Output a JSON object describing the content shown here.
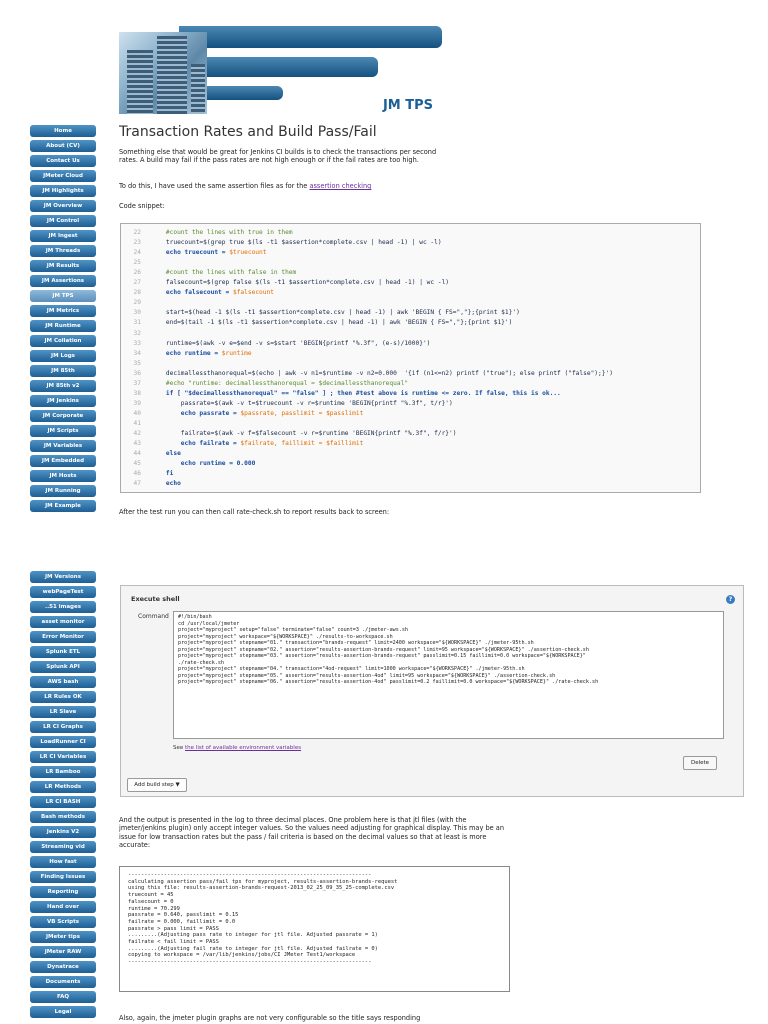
{
  "header": {
    "brand": "JM TPS"
  },
  "sidebar_top": [
    "Home",
    "About (CV)",
    "Contact Us",
    "JMeter Cloud",
    "JM Highlights",
    "JM Overview",
    "JM Control",
    "JM Ingest",
    "JM Threads",
    "JM Results",
    "JM Assertions",
    "JM TPS",
    "JM Metrics",
    "JM Runtime",
    "JM Collation",
    "JM Logs",
    "JM 85th",
    "JM 85th v2",
    "JM Jenkins",
    "JM Corporate",
    "JM Scripts",
    "JM Variables",
    "JM Embedded",
    "JM Hosts",
    "JM Running",
    "JM Example"
  ],
  "sidebar_top_selected": 11,
  "sidebar_bottom": [
    "JM Versions",
    "webPageTest",
    "..51 images",
    "asset monitor",
    "Error Monitor",
    "Splunk ETL",
    "Splunk API",
    "AWS bash",
    "LR Rules OK",
    "LR Slave",
    "LR CI Graphs",
    "LoadRunner CI",
    "LR CI Variables",
    "LR Bamboo",
    "LR Methods",
    "LR CI BASH",
    "Bash methods",
    "Jenkins V2",
    "Streaming vid",
    "How fast",
    "Finding Issues",
    "Reporting",
    "Hand over",
    "VB Scripts",
    "JMeter tips",
    "JMeter RAW",
    "Dynatrace",
    "Documents",
    "FAQ",
    "Legal"
  ],
  "content": {
    "title": "Transaction Rates and Build Pass/Fail",
    "intro": "Something else that would be great for Jenkins CI builds is to check the transactions per second rates. A build may fail if the pass rates are not high enough or if the fail rates are too high.",
    "todo_prefix": "To do this, I have used the same assertion files as for the ",
    "todo_link": "assertion checking",
    "code_label": "Code snippet:",
    "after_code": "After the test run you can then call rate-check.sh to report results back to screen:",
    "output_para": "And the output is presented in the log to three decimal places. One problem here is that jtl files (with the jmeter/jenkins plugin) only accept integer values. So the values need adjusting for graphical display. This may be an issue for low transaction rates but the pass / fail criteria is based on the decimal values so that at least is more accurate:",
    "bottom_para": "Also, again, the jmeter plugin graphs are not very configurable so the title says responding"
  },
  "code_snippet": [
    {
      "n": "22",
      "t": "    #count the lines with true in them",
      "k": "com"
    },
    {
      "n": "23",
      "t": "    truecount=$(grep true $(ls -t1 $assertion*complete.csv | head -1) | wc -l)",
      "k": "txt"
    },
    {
      "n": "24",
      "t": "    echo truecount = $truecount",
      "k": "echo"
    },
    {
      "n": "25",
      "t": "",
      "k": "txt"
    },
    {
      "n": "26",
      "t": "    #count the lines with false in them",
      "k": "com"
    },
    {
      "n": "27",
      "t": "    falsecount=$(grep false $(ls -t1 $assertion*complete.csv | head -1) | wc -l)",
      "k": "txt"
    },
    {
      "n": "28",
      "t": "    echo falsecount = $falsecount",
      "k": "echo"
    },
    {
      "n": "29",
      "t": "",
      "k": "txt"
    },
    {
      "n": "30",
      "t": "    start=$(head -1 $(ls -t1 $assertion*complete.csv | head -1) | awk 'BEGIN { FS=\",\"};{print $1}')",
      "k": "txt"
    },
    {
      "n": "31",
      "t": "    end=$(tail -1 $(ls -t1 $assertion*complete.csv | head -1) | awk 'BEGIN { FS=\",\"};{print $1}')",
      "k": "txt"
    },
    {
      "n": "32",
      "t": "",
      "k": "txt"
    },
    {
      "n": "33",
      "t": "    runtime=$(awk -v e=$end -v s=$start 'BEGIN{printf \"%.3f\", (e-s)/1000}')",
      "k": "txt"
    },
    {
      "n": "34",
      "t": "    echo runtime = $runtime",
      "k": "echo"
    },
    {
      "n": "35",
      "t": "",
      "k": "txt"
    },
    {
      "n": "36",
      "t": "    decimallessthanorequal=$(echo | awk -v n1=$runtime -v n2=0.000  '{if (n1<=n2) printf (\"true\"); else printf (\"false\");}')",
      "k": "txt"
    },
    {
      "n": "37",
      "t": "    #echo \"runtime: decimallessthanorequal = $decimallessthanorequal\"",
      "k": "com"
    },
    {
      "n": "38",
      "t": "    if [ \"$decimallessthanorequal\" == \"false\" ] ; then #test above is runtime <= zero. If false, this is ok...",
      "k": "if"
    },
    {
      "n": "39",
      "t": "        passrate=$(awk -v t=$truecount -v r=$runtime 'BEGIN{printf \"%.3f\", t/r}')",
      "k": "txt"
    },
    {
      "n": "40",
      "t": "        echo passrate = $passrate, passlimit = $passlimit",
      "k": "echo"
    },
    {
      "n": "41",
      "t": "",
      "k": "txt"
    },
    {
      "n": "42",
      "t": "        failrate=$(awk -v f=$falsecount -v r=$runtime 'BEGIN{printf \"%.3f\", f/r}')",
      "k": "txt"
    },
    {
      "n": "43",
      "t": "        echo failrate = $failrate, faillimit = $faillimit",
      "k": "echo"
    },
    {
      "n": "44",
      "t": "    else",
      "k": "kw"
    },
    {
      "n": "45",
      "t": "        echo runtime = 0.000",
      "k": "echo"
    },
    {
      "n": "46",
      "t": "    fi",
      "k": "kw"
    },
    {
      "n": "47",
      "t": "    echo",
      "k": "kw"
    }
  ],
  "jenkins": {
    "header": "Execute shell",
    "help": "?",
    "label": "Command",
    "command_lines": [
      "#!/bin/bash",
      "",
      "cd /usr/local/jmeter",
      "project=\"myproject\" setup=\"false\" terminate=\"false\" count=3 ./jmeter-aws.sh",
      "",
      "project=\"myproject\" workspace=\"${WORKSPACE}\" ./results-to-workspace.sh",
      "",
      "project=\"myproject\" stepname=\"01.\" transaction=\"brands-request\" limit=2400 workspace=\"${WORKSPACE}\" ./jmeter-95th.sh",
      "project=\"myproject\" stepname=\"02.\" assertion=\"results-assertion-brands-request\" limit=95 workspace=\"${WORKSPACE}\" ./assertion-check.sh",
      "project=\"myproject\" stepname=\"03.\" assertion=\"results-assertion-brands-request\" passlimit=0.15 faillimit=0.0 workspace=\"${WORKSPACE}\"",
      "./rate-check.sh",
      "",
      "project=\"myproject\" stepname=\"04.\" transaction=\"4od-request\" limit=1000 workspace=\"${WORKSPACE}\" ./jmeter-95th.sh",
      "project=\"myproject\" stepname=\"05.\" assertion=\"results-assertion-4od\" limit=95 workspace=\"${WORKSPACE}\" ./assertion-check.sh",
      "project=\"myproject\" stepname=\"06.\" assertion=\"results-assertion-4od\" passlimit=0.2 faillimit=0.0 workspace=\"${WORKSPACE}\" ./rate-check.sh"
    ],
    "see_prefix": "See ",
    "see_link": "the list of available environment variables",
    "delete": "Delete",
    "add_step": "Add build step ▼"
  },
  "output_lines": [
    "---------------------------------------------------------------------------",
    "calculating assertion pass/fail tps for myproject, results-assertion-brands-request",
    "using this file: results-assertion-brands-request-2013_02_25_09_35_25-complete.csv",
    "truecount = 45",
    "falsecount = 0",
    "runtime = 70.299",
    "passrate = 0.640, passlimit = 0.15",
    "failrate = 0.000, faillimit = 0.0",
    "",
    "passrate > pass limit = PASS",
    ".........(Adjusting pass rate to integer for jtl file. Adjusted passrate = 1)",
    "failrate < fail limit = PASS",
    ".........(Adjusting fail rate to integer for jtl file. Adjusted failrate = 0)",
    "copying to workspace = /var/lib/jenkins/jobs/CI JMeter Test1/workspace",
    "---------------------------------------------------------------------------"
  ]
}
